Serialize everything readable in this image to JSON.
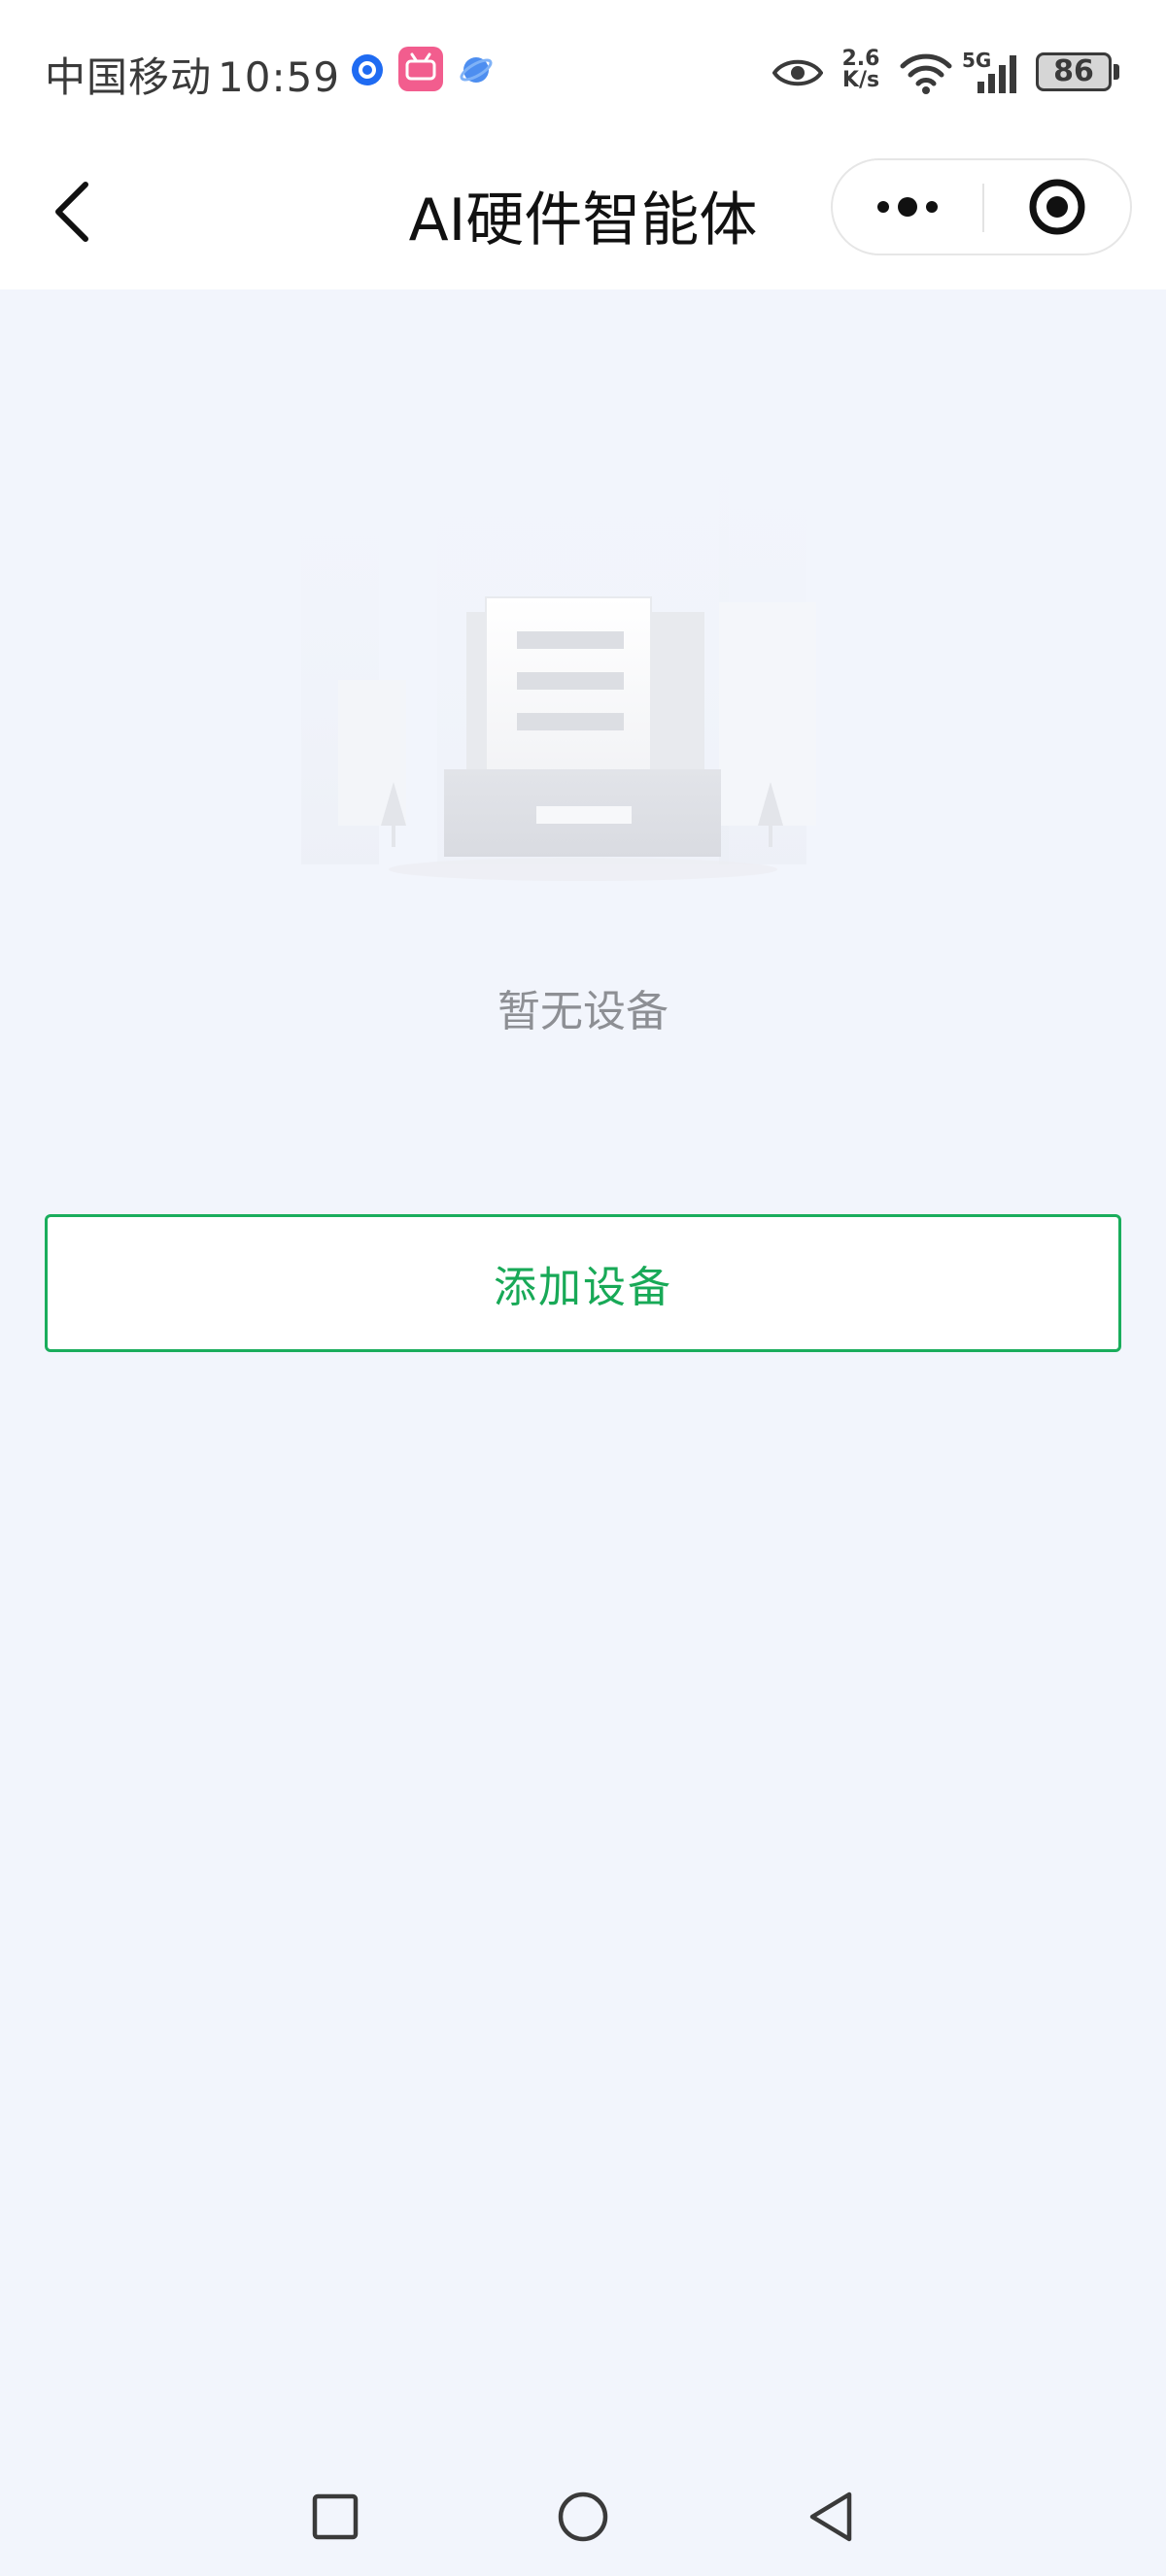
{
  "status_bar": {
    "carrier": "中国移动",
    "time": "10:59",
    "speed_top": "2.6",
    "speed_bottom": "K/s",
    "network": "5G",
    "battery": "86"
  },
  "nav": {
    "title": "AI硬件智能体"
  },
  "empty_state": {
    "message": "暂无设备"
  },
  "actions": {
    "add_device": "添加设备"
  },
  "colors": {
    "accent": "#18a957",
    "background": "#f2f5fc"
  }
}
